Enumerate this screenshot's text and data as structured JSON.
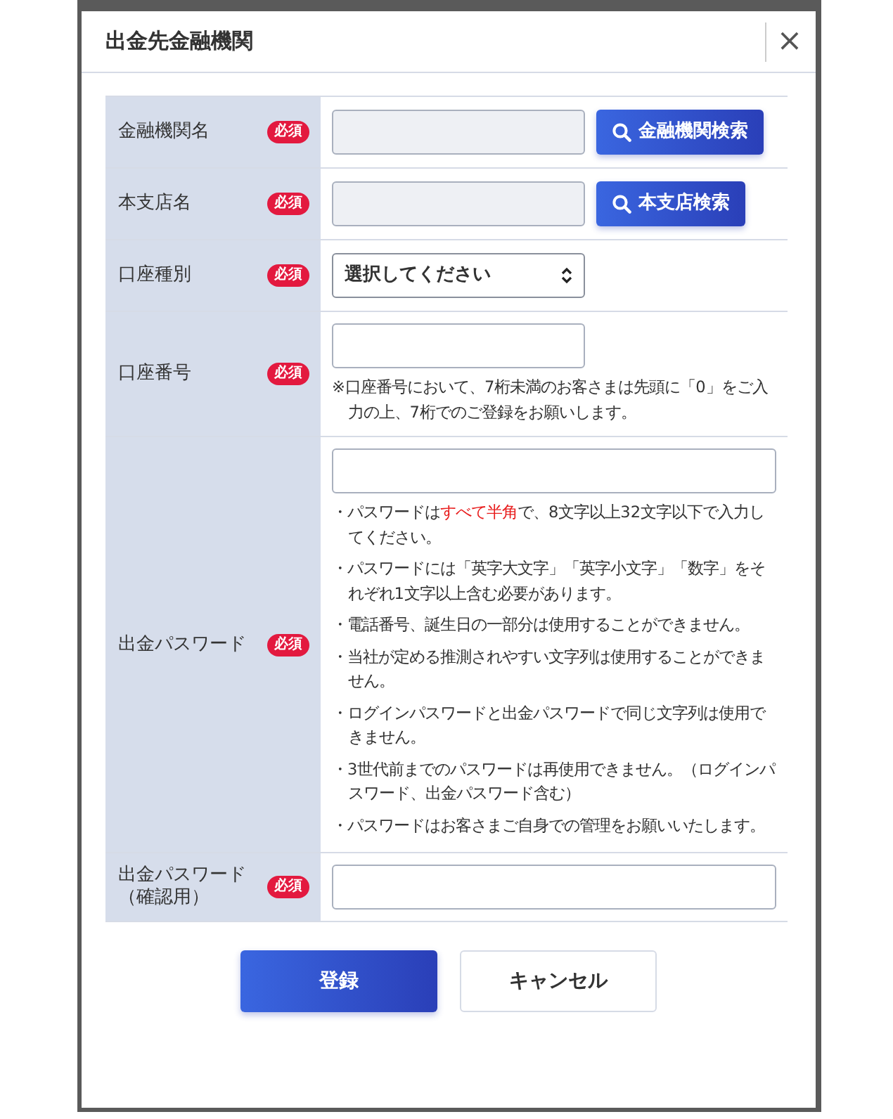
{
  "dialog": {
    "title": "出金先金融機関",
    "close": "×"
  },
  "rows": [
    {
      "kind": "search",
      "label": "金融機関名",
      "required": "必須",
      "disabled": true,
      "button": "金融機関検索"
    },
    {
      "kind": "search",
      "label": "本支店名",
      "required": "必須",
      "disabled": true,
      "button": "本支店検索"
    },
    {
      "kind": "select",
      "label": "口座種別",
      "required": "必須",
      "value": "選択してください"
    },
    {
      "kind": "note",
      "label": "口座番号",
      "required": "必須",
      "note": "※口座番号において、7桁未満のお客さまは先頭に「0」をご入力の上、7桁でのご登録をお願いします。"
    },
    {
      "kind": "notes",
      "label": "出金パスワード",
      "required": "必須",
      "notes": [
        [
          {
            "text": "・パスワードは",
            "highlight": false
          },
          {
            "text": "すべて半角",
            "highlight": true
          },
          {
            "text": "で、8文字以上32文字以下で入力してください。",
            "highlight": false
          }
        ],
        [
          {
            "text": "・パスワードには「英字大文字」「英字小文字」「数字」をそれぞれ1文字以上含む必要があります。",
            "highlight": false
          }
        ],
        [
          {
            "text": "・電話番号、誕生日の一部分は使用することができません。",
            "highlight": false
          }
        ],
        [
          {
            "text": "・当社が定める推測されやすい文字列は使用することができません。",
            "highlight": false
          }
        ],
        [
          {
            "text": "・ログインパスワードと出金パスワードで同じ文字列は使用できません。",
            "highlight": false
          }
        ],
        [
          {
            "text": "・3世代前までのパスワードは再使用できません。（ログインパスワード、出金パスワード含む）",
            "highlight": false
          }
        ],
        [
          {
            "text": "・パスワードはお客さまご自身での管理をお願いいたします。",
            "highlight": false
          }
        ]
      ]
    },
    {
      "kind": "plain",
      "label": "出金パスワード（確認用）",
      "required": "必須"
    }
  ],
  "buttons": [
    {
      "label": "登録",
      "kind": "primary"
    },
    {
      "label": "キャンセル",
      "kind": "secondary"
    }
  ]
}
